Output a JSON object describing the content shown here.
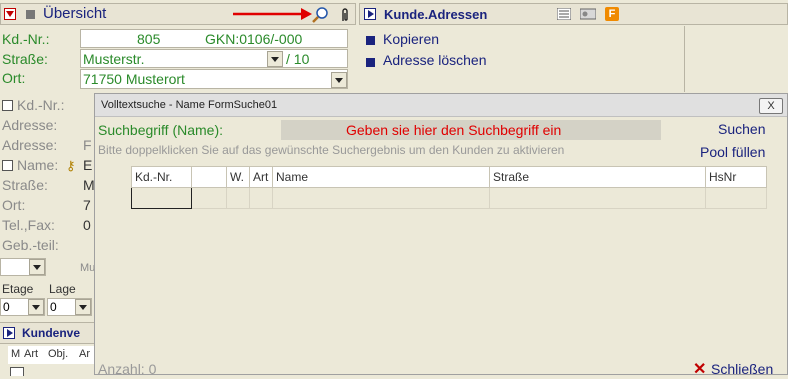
{
  "overview": {
    "title": "Übersicht"
  },
  "address_header": {
    "title": "Kunde.Adressen"
  },
  "customer": {
    "kdnr_label": "Kd.-Nr.:",
    "kdnr_value": "805",
    "gkn_value": "GKN:0106/-000",
    "street_label": "Straße:",
    "street_value": "Musterstr.",
    "house_value": "/ 10",
    "city_label": "Ort:",
    "city_value": "71750 Musterort"
  },
  "actions": {
    "copy": "Kopieren",
    "delete": "Adresse löschen"
  },
  "left_panel": {
    "kdnr": "Kd.-Nr.:",
    "adresse1": "Adresse:",
    "adresse2": "Adresse:",
    "adresse2_value": "F",
    "name": "Name:",
    "name_value": "E",
    "strasse": "Straße:",
    "strasse_value": "M",
    "ort": "Ort:",
    "ort_value": "7",
    "telfax": "Tel.,Fax:",
    "telfax_value": "0",
    "gebteil": "Geb.-teil:",
    "mu": "Mu",
    "etage": "Etage",
    "lage": "Lage",
    "etage_value": "0",
    "lage_value": "0",
    "kundenve": "Kundenve",
    "cols": [
      "M",
      "Art",
      "Obj.",
      "Ar"
    ]
  },
  "dialog": {
    "title": "Volltextsuche - Name FormSuche01",
    "close_label": "X",
    "search_label": "Suchbegriff (Name):",
    "search_placeholder": "Geben sie hier den Suchbegriff ein",
    "hint": "Bitte doppelklicken Sie auf das gewünschte Suchergebnis um den Kunden zu aktivieren",
    "search_button": "Suchen",
    "pool_button": "Pool füllen",
    "columns": [
      "Kd.-Nr.",
      "",
      "W.",
      "Art",
      "Name",
      "Straße",
      "HsNr"
    ],
    "count": "Anzahl: 0",
    "close_button": "Schließen"
  },
  "colors": {
    "green_text": "#2a8a2a",
    "navy": "#1a237e",
    "red_placeholder": "#e00000"
  }
}
